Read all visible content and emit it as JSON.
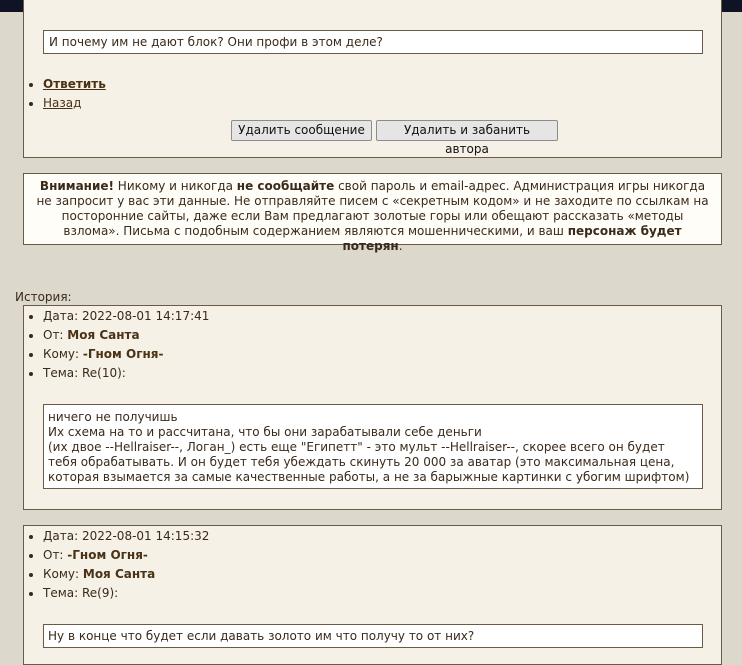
{
  "reply": {
    "quoted_text": "И почему им не дают блок? Они профи в этом деле?",
    "links": [
      "Ответить",
      "Назад"
    ],
    "delete_button": "Удалить сообщение",
    "delete_ban_button": "Удалить и забанить автора"
  },
  "warning": {
    "p1_b": "Внимание!",
    "p2": " Никому и никогда ",
    "p3_b": "не сообщайте",
    "p4": " свой пароль и email-адрес. Администрация игры никогда не запросит у вас эти данные. Не отправляйте писем с «секретным кодом» и не заходите по ссылкам на посторонние сайты, даже если Вам предлагают золотые горы или обещают рассказать «методы взлома». Письма с подобным содержанием являются мошенническими, и ваш ",
    "p5_b": "персонаж будет потерян",
    "p6": "."
  },
  "history": {
    "label": "История:",
    "field_labels": {
      "date": "Дата: ",
      "from": "От: ",
      "to": "Кому: ",
      "subject": "Тема: "
    },
    "messages": [
      {
        "date": "2022-08-01 14:17:41",
        "from": "Моя Санта",
        "to": "-Гном Огня-",
        "subject": "Re(10):",
        "lines": [
          "ничего не получишь",
          "Их схема на то и рассчитана, что бы они зарабатывали себе деньги",
          "(их двое --Hellraiser--, Логан_) есть еще \"Египетт\" - это мульт --Hellraiser--, скорее всего он будет",
          "тебя обрабатывать. И он будет тебя убеждать скинуть 20 000 за аватар (это максимальная цена,",
          "которая взымается за самые качественные работы, а не за барыжные картинки с убогим шрифтом)"
        ]
      },
      {
        "date": "2022-08-01 14:15:32",
        "from": "-Гном Огня-",
        "to": "Моя Санта",
        "subject": "Re(9):",
        "lines": [
          "Ну в конце что будет если давать золото им что получу то от них?"
        ]
      }
    ]
  }
}
